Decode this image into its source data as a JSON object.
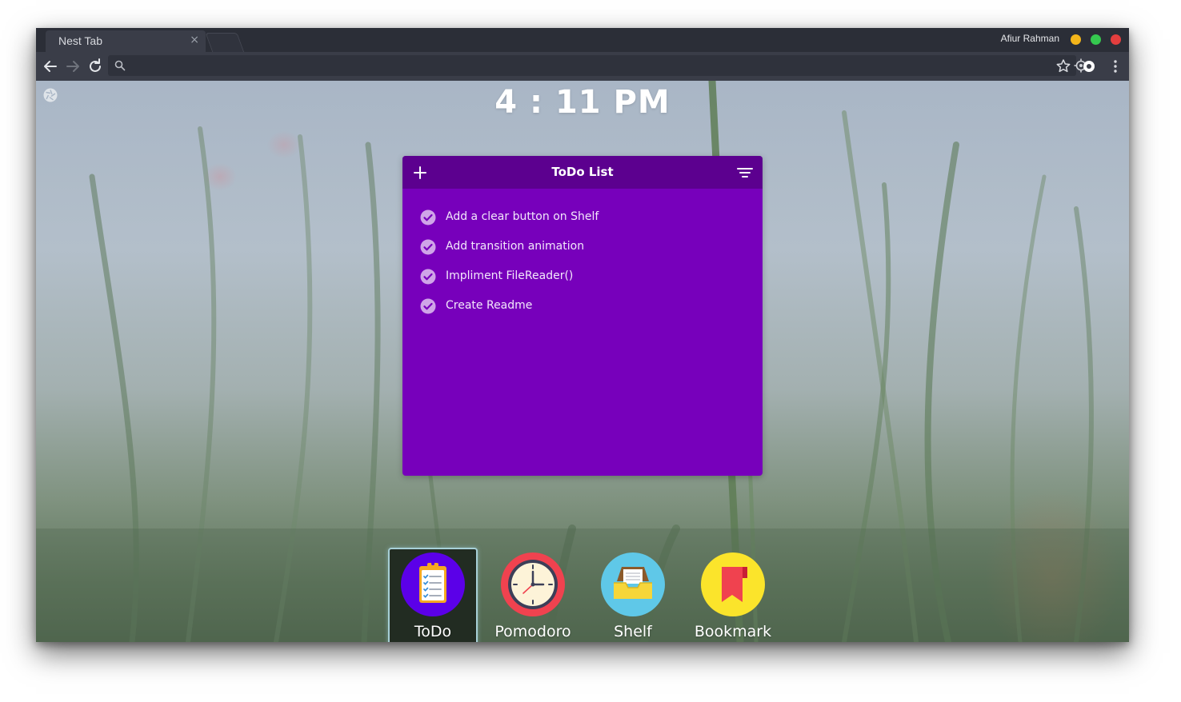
{
  "browser": {
    "tab_title": "Nest Tab",
    "tab_close": "×",
    "profile_name": "Afiur Rahman",
    "address_value": "",
    "address_placeholder": ""
  },
  "clock": {
    "time": "4 : 11 PM"
  },
  "todo": {
    "title": "ToDo List",
    "items": [
      {
        "text": "Add a clear button on Shelf",
        "done": true
      },
      {
        "text": "Add transition animation",
        "done": true
      },
      {
        "text": "Impliment FileReader()",
        "done": true
      },
      {
        "text": "Create Readme",
        "done": true
      }
    ]
  },
  "dock": {
    "apps": [
      {
        "label": "ToDo",
        "icon": "clipboard-icon",
        "active": true
      },
      {
        "label": "Pomodoro",
        "icon": "clock-icon",
        "active": false
      },
      {
        "label": "Shelf",
        "icon": "inbox-tray-icon",
        "active": false
      },
      {
        "label": "Bookmark",
        "icon": "bookmark-icon",
        "active": false
      }
    ]
  },
  "colors": {
    "todo_header": "#5c008f",
    "todo_body": "#7700bb",
    "todo_icon_bg": "#5b00e8",
    "pomodoro_ring": "#f0424f",
    "shelf_bg": "#5fc8e8",
    "bookmark_bg": "#fbe42b",
    "bookmark_ribbon": "#f0424f"
  }
}
